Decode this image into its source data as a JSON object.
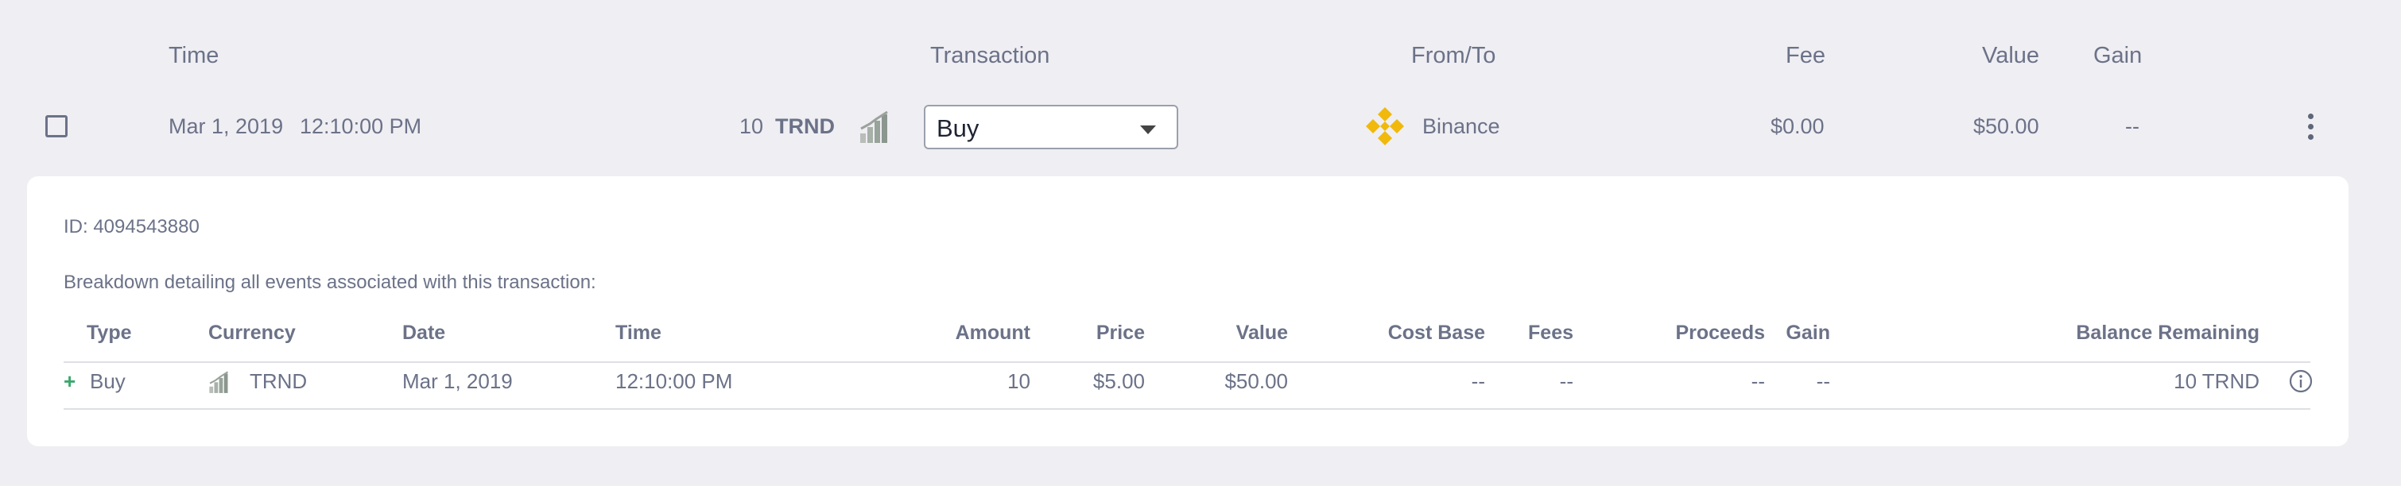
{
  "header": {
    "time": "Time",
    "transaction": "Transaction",
    "from_to": "From/To",
    "fee": "Fee",
    "value": "Value",
    "gain": "Gain"
  },
  "row": {
    "date": "Mar 1, 2019",
    "time": "12:10:00 PM",
    "amount": "10",
    "currency": "TRND",
    "transaction_type": "Buy",
    "exchange": "Binance",
    "fee": "$0.00",
    "value": "$50.00",
    "gain": "--"
  },
  "details": {
    "id_text": "ID: 4094543880",
    "description": "Breakdown detailing all events associated with this transaction:",
    "columns": [
      "Type",
      "Currency",
      "Date",
      "Time",
      "Amount",
      "Price",
      "Value",
      "Cost Base",
      "Fees",
      "Proceeds",
      "Gain",
      "Balance Remaining"
    ],
    "rows": [
      {
        "marker": "+",
        "type": "Buy",
        "currency": "TRND",
        "date": "Mar 1, 2019",
        "time": "12:10:00 PM",
        "amount": "10",
        "price": "$5.00",
        "value": "$50.00",
        "cost_base": "--",
        "fees": "--",
        "proceeds": "--",
        "gain": "--",
        "balance_remaining": "10 TRND"
      }
    ]
  },
  "icons": {
    "row_menu": "kebab-icon",
    "currency_logo": "trnd-coin-icon",
    "exchange_logo": "binance-logo-icon",
    "balance_info": "info-icon",
    "dropdown": "chevron-down-icon"
  },
  "colors": {
    "background": "#efeef3",
    "panel": "#ffffff",
    "text": "#6b7288",
    "binance": "#f0b90b",
    "buy_marker": "#3aa76d"
  }
}
